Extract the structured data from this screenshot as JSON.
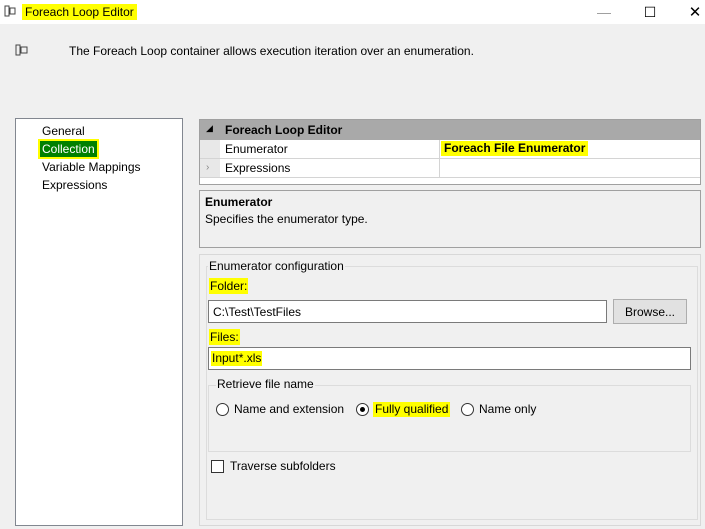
{
  "window": {
    "title": "Foreach Loop Editor",
    "minimize_glyph": "—",
    "maximize_glyph": "☐",
    "close_glyph": "✕"
  },
  "header": {
    "description": "The Foreach Loop container allows execution iteration over an enumeration."
  },
  "nav": {
    "items": [
      {
        "label": "General",
        "selected": false
      },
      {
        "label": "Collection",
        "selected": true
      },
      {
        "label": "Variable Mappings",
        "selected": false
      },
      {
        "label": "Expressions",
        "selected": false
      }
    ]
  },
  "property_grid": {
    "category": "Foreach Loop Editor",
    "rows": [
      {
        "name": "Enumerator",
        "value": "Foreach File Enumerator"
      },
      {
        "name": "Expressions",
        "value": ""
      }
    ]
  },
  "description_box": {
    "title": "Enumerator",
    "text": "Specifies the enumerator type."
  },
  "config": {
    "group_label": "Enumerator configuration",
    "folder_label": "Folder:",
    "folder_value": "C:\\Test\\TestFiles",
    "browse_label": "Browse...",
    "files_label": "Files:",
    "files_value": "Input*.xls",
    "retrieve_label": "Retrieve file name",
    "radios": [
      {
        "label": "Name and extension",
        "checked": false
      },
      {
        "label": "Fully qualified",
        "checked": true
      },
      {
        "label": "Name only",
        "checked": false
      }
    ],
    "traverse_label": "Traverse subfolders",
    "traverse_checked": false
  },
  "colors": {
    "highlight": "#ffff00",
    "selected_nav_bg": "#008000",
    "grid_header_bg": "#a9a9a9"
  }
}
